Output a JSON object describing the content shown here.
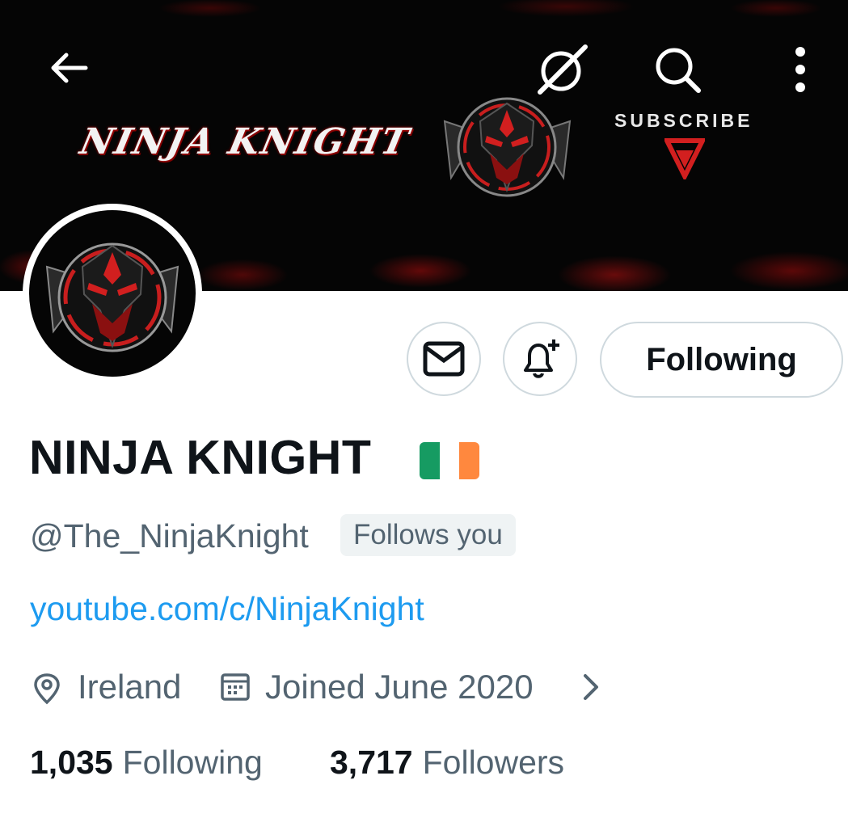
{
  "banner": {
    "title": "NINJA KNIGHT",
    "subscribe": "SUBSCRIBE"
  },
  "header_icons": [
    "arrow-left-icon",
    "grok-icon",
    "search-icon",
    "more-vertical-icon"
  ],
  "actions": {
    "following_label": "Following"
  },
  "profile": {
    "display_name": "NINJA KNIGHT",
    "handle": "@The_NinjaKnight",
    "follows_you": "Follows you",
    "link": "youtube.com/c/NinjaKnight",
    "location": "Ireland",
    "joined": "Joined June 2020"
  },
  "stats": {
    "following_count": "1,035",
    "following_label": "Following",
    "followers_count": "3,717",
    "followers_label": "Followers"
  },
  "colors": {
    "link": "#1d9bf0",
    "muted": "#536471",
    "flag_green": "#169b62",
    "flag_white": "#ffffff",
    "flag_orange": "#ff883e",
    "accent_red": "#d21f1f"
  }
}
